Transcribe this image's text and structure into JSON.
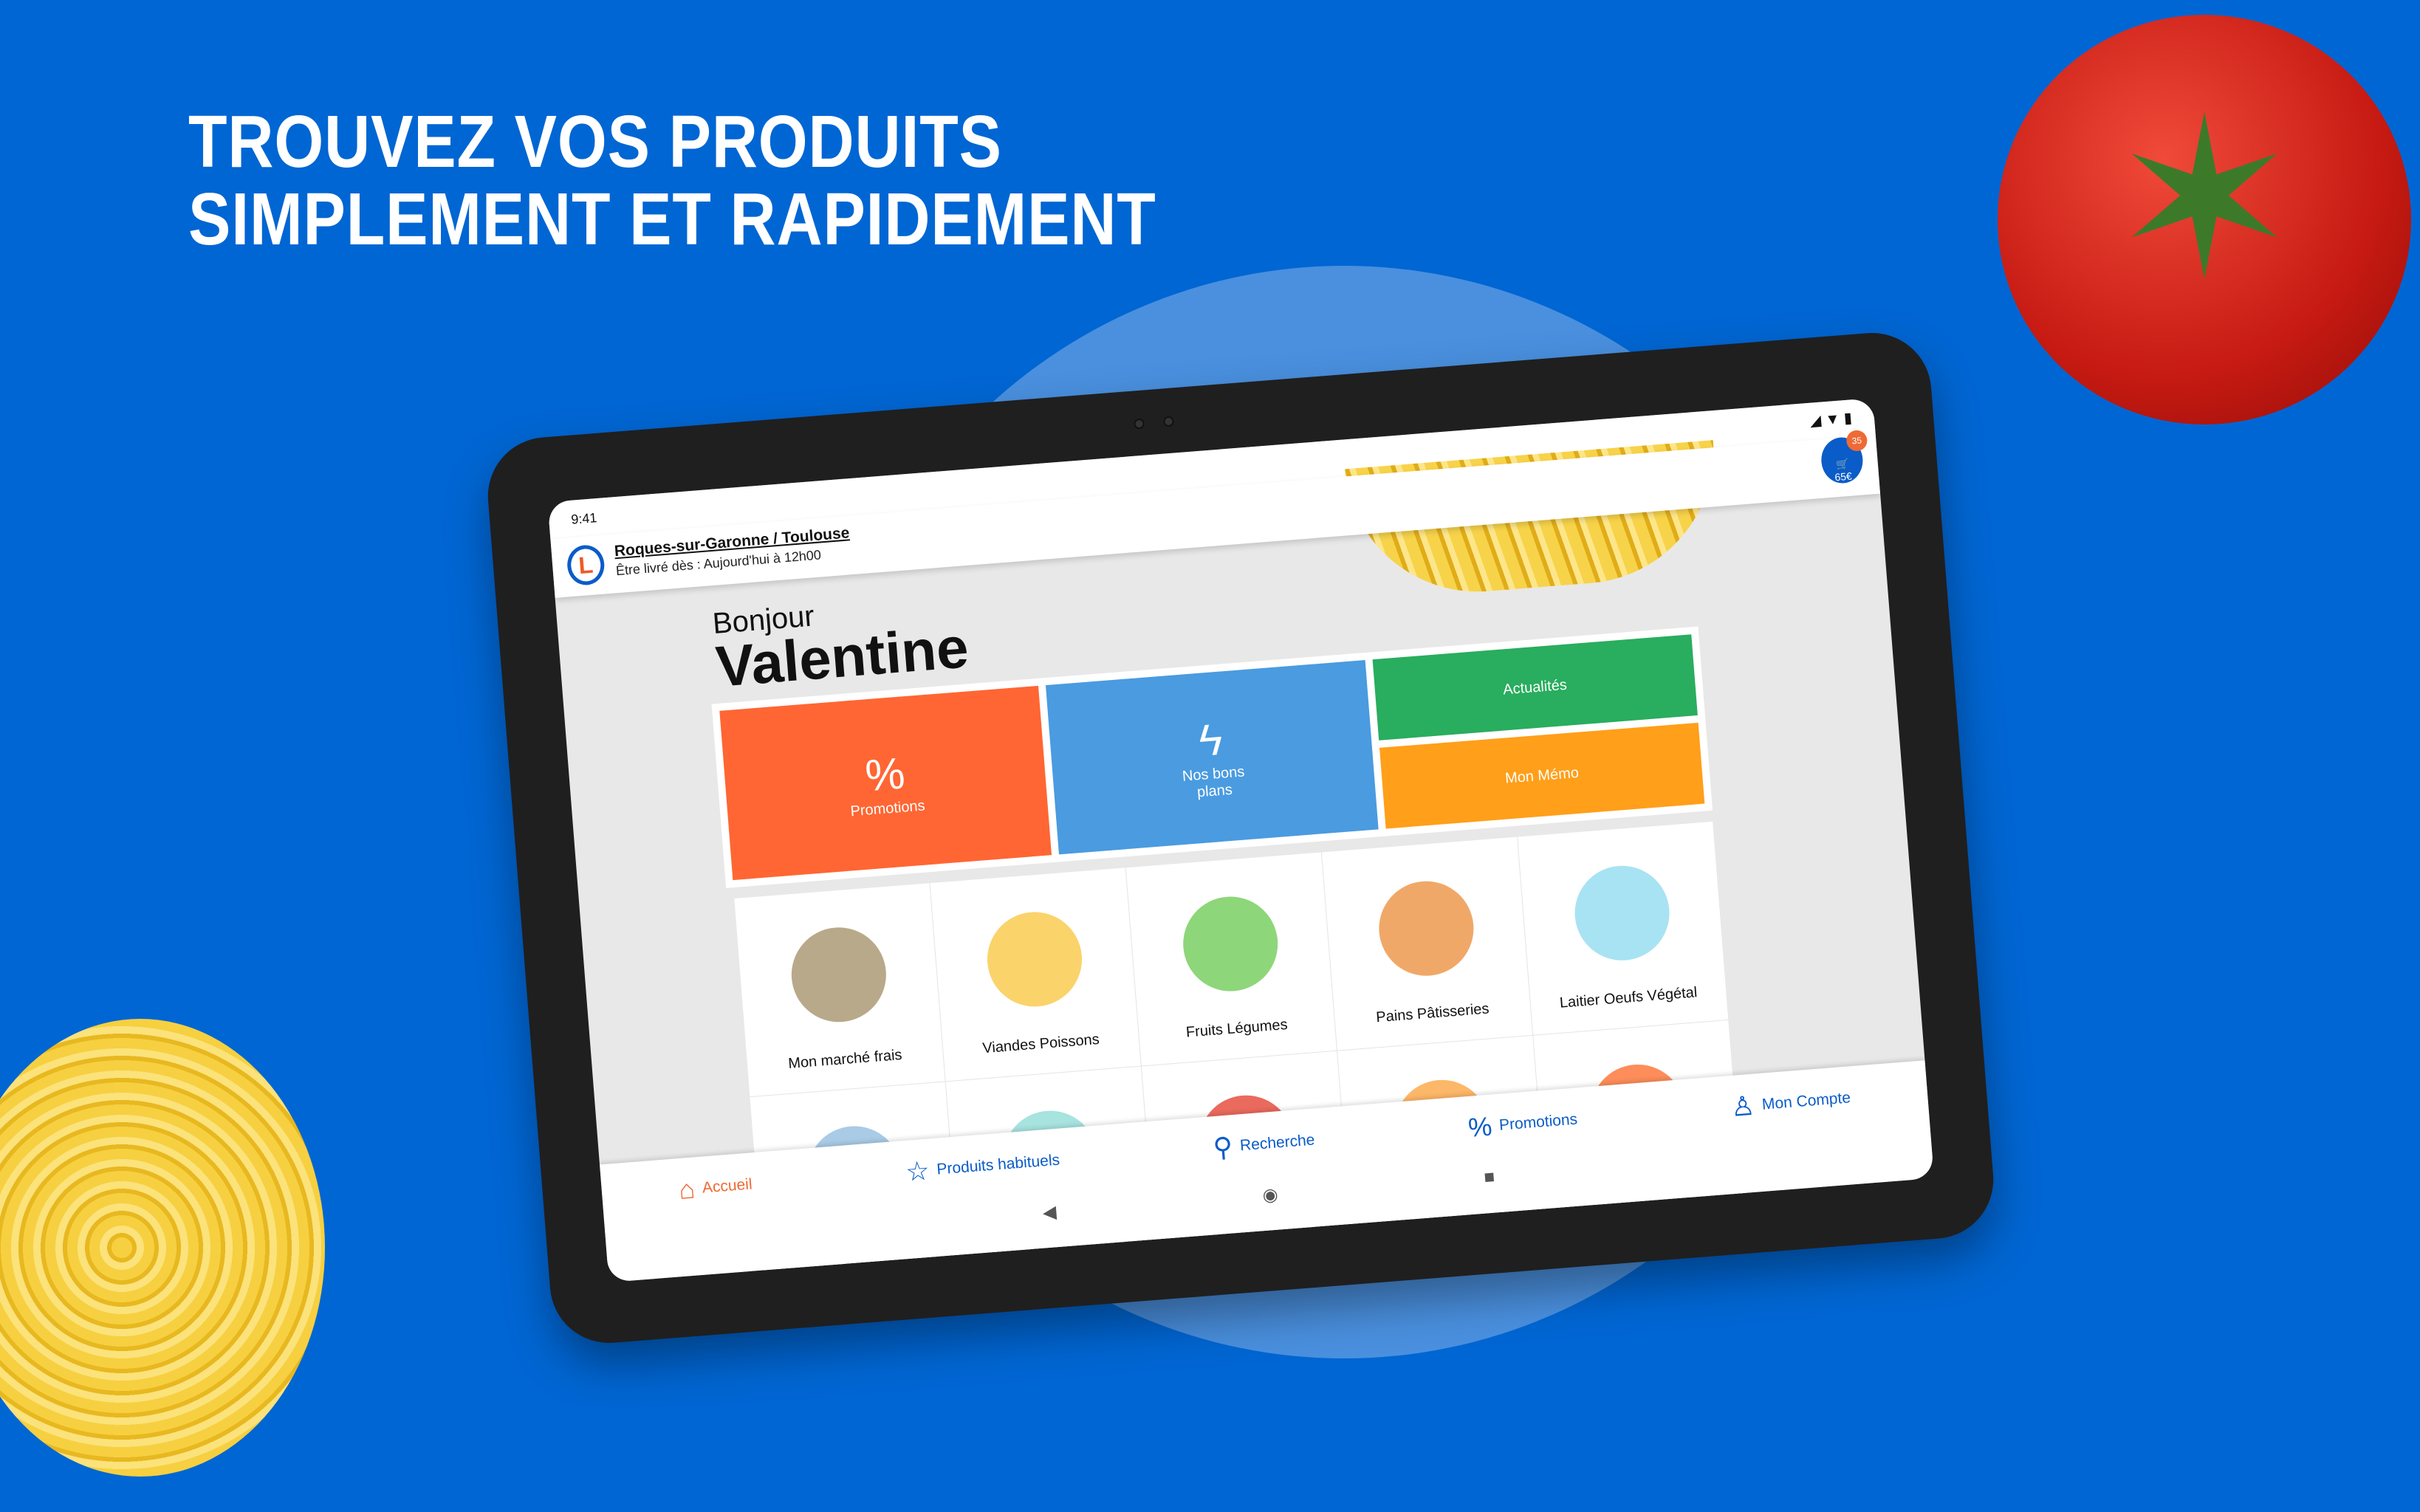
{
  "headline": {
    "line1": "TROUVEZ VOS PRODUITS",
    "line2": "SIMPLEMENT ET RAPIDEMENT"
  },
  "colors": {
    "background": "#0066d3",
    "promotions": "#ff6633",
    "bons_plans": "#4a9be0",
    "actualites": "#29ad5e",
    "memo": "#ff9f1a",
    "brand_blue": "#0a5cc8",
    "active_nav": "#ef6a34"
  },
  "status_bar": {
    "time": "9:41"
  },
  "header": {
    "location": "Roques-sur-Garonne / Toulouse",
    "delivery": "Être livré dès : Aujourd'hui à 12h00",
    "cart_count": "35",
    "cart_total": "65€"
  },
  "greeting": {
    "hello": "Bonjour",
    "name": "Valentine"
  },
  "tiles": [
    {
      "label": "Promotions",
      "icon": "percent-icon"
    },
    {
      "label": "Nos bons plans",
      "icon": "lightning-icon"
    },
    {
      "label": "Actualités"
    },
    {
      "label": "Mon Mémo"
    }
  ],
  "categories": [
    {
      "label": "Mon marché frais",
      "color": "#b8a98a"
    },
    {
      "label": "Viandes Poissons",
      "color": "#fbd36b"
    },
    {
      "label": "Fruits Légumes",
      "color": "#8ed67a"
    },
    {
      "label": "Pains Pâtisseries",
      "color": "#f0a868"
    },
    {
      "label": "Laitier Oeufs Végétal",
      "color": "#a8e3f3"
    },
    {
      "label": "",
      "color": "#a9cbe6"
    },
    {
      "label": "",
      "color": "#a7e3df"
    },
    {
      "label": "",
      "color": "#ea6a5e"
    },
    {
      "label": "",
      "color": "#fdb768"
    },
    {
      "label": "",
      "color": "#fd8d5a"
    }
  ],
  "nav": [
    {
      "label": "Accueil",
      "icon": "home-icon",
      "active": true
    },
    {
      "label": "Produits habituels",
      "icon": "star-icon"
    },
    {
      "label": "Recherche",
      "icon": "search-icon"
    },
    {
      "label": "Promotions",
      "icon": "percent-icon"
    },
    {
      "label": "Mon Compte",
      "icon": "user-icon"
    }
  ]
}
